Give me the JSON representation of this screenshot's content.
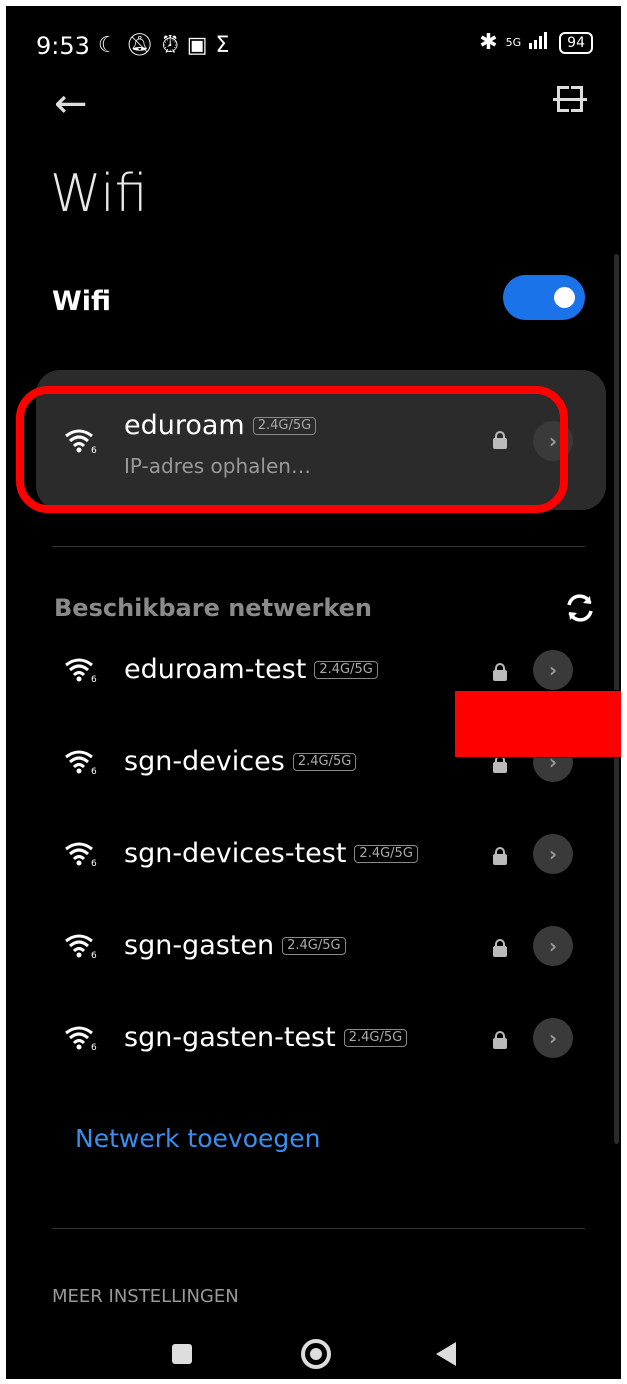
{
  "status_bar": {
    "time": "9:53",
    "left_icons": [
      "moon-icon",
      "mute-icon",
      "alarm-icon",
      "app-notification-icon",
      "sigma-icon"
    ],
    "net_label": "5G",
    "battery": "94"
  },
  "header": {
    "title": "Wifi"
  },
  "wifi_toggle": {
    "label": "Wifi",
    "on": true,
    "accent": "#1a73e8"
  },
  "connected": {
    "ssid": "eduroam",
    "band": "2.4G/5G",
    "status": "IP-adres ophalen…"
  },
  "available": {
    "heading": "Beschikbare netwerken",
    "networks": [
      {
        "ssid": "eduroam-test",
        "band": "2.4G/5G"
      },
      {
        "ssid": "sgn-devices",
        "band": "2.4G/5G"
      },
      {
        "ssid": "sgn-devices-test",
        "band": "2.4G/5G"
      },
      {
        "ssid": "sgn-gasten",
        "band": "2.4G/5G"
      },
      {
        "ssid": "sgn-gasten-test",
        "band": "2.4G/5G"
      }
    ]
  },
  "add_network": "Netwerk toevoegen",
  "more_settings": "MEER INSTELLINGEN"
}
